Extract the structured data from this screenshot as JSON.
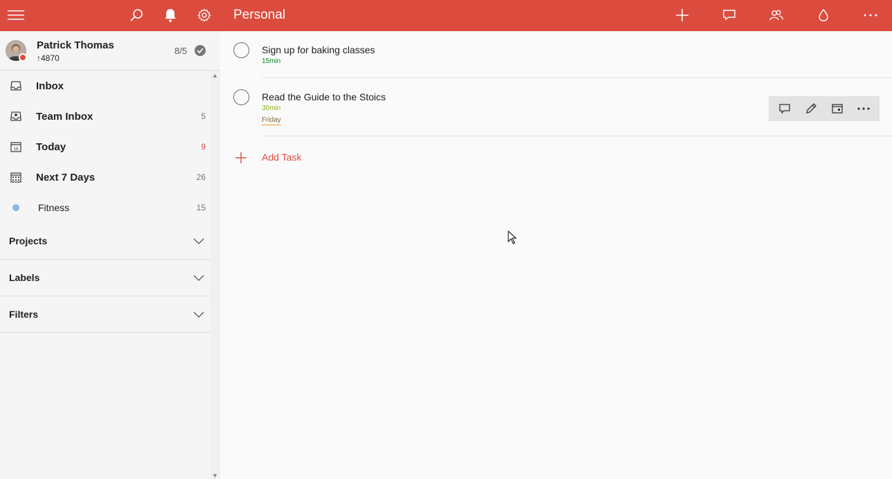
{
  "topbar": {
    "title": "Personal",
    "icons": {
      "menu": "hamburger-icon",
      "search": "search-icon",
      "notifications": "bell-icon",
      "settings": "gear-icon",
      "add": "plus-icon",
      "comments": "comment-icon",
      "share": "people-icon",
      "color": "drop-icon",
      "more": "more-icon"
    },
    "color": "#db4c3f"
  },
  "profile": {
    "name": "Patrick Thomas",
    "karma": "↑4870",
    "goal": "8/5"
  },
  "sidebar": {
    "items": [
      {
        "label": "Inbox",
        "count": ""
      },
      {
        "label": "Team Inbox",
        "count": "5"
      },
      {
        "label": "Today",
        "count": "9",
        "calendar_day": "18"
      },
      {
        "label": "Next 7 Days",
        "count": "26"
      },
      {
        "label": "Fitness",
        "count": "15",
        "color": "#7ecc49"
      }
    ],
    "sections": [
      {
        "label": "Projects"
      },
      {
        "label": "Labels"
      },
      {
        "label": "Filters"
      }
    ]
  },
  "tasks": [
    {
      "title": "Sign up for baking classes",
      "duration": "15min",
      "duration_color": "#058527",
      "date": ""
    },
    {
      "title": "Read the Guide to the Stoics",
      "duration": "30min",
      "duration_color": "#8cb51c",
      "date": "Friday"
    }
  ],
  "add_task": {
    "label": "Add Task"
  }
}
